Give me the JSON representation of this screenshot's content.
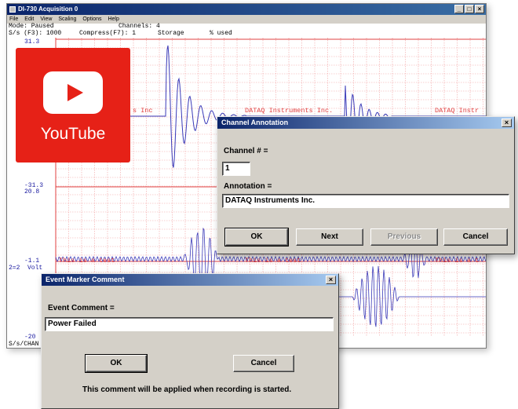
{
  "main_window": {
    "title": "DI-730 Acquisition 0",
    "controls": [
      "_",
      "□",
      "×"
    ],
    "menu": [
      "File",
      "Edit",
      "View",
      "Scaling",
      "Options",
      "Help"
    ],
    "status_line1": [
      "Mode: Paused",
      "Channels: 4"
    ],
    "status_line2": [
      "S/s (F3): 1000",
      "Compress(F7): 1",
      "Storage",
      "% used"
    ],
    "scale_labels": {
      "ch1_top": "31.3",
      "ch1_bottom": "-31.3",
      "ch2_top": "20.8",
      "ch2_bottom": "-1.1",
      "ch2_unit": "2=2  Volt",
      "ch3_bottom": "-20"
    },
    "annotations_top": [
      "s Inc",
      "DATAQ Instruments Inc.",
      "DATAQ Instr"
    ],
    "annotations_bottom": [
      "This is a test",
      "This is a test",
      "This is a t"
    ],
    "bottom_label": "S/s/CHAN"
  },
  "youtube_badge": {
    "word": "YouTube",
    "icon": "play-icon",
    "brand_color": "#e62117"
  },
  "channel_dialog": {
    "title": "Channel Annotation",
    "close": "×",
    "channel_label": "Channel # =",
    "channel_value": "1",
    "annotation_label": "Annotation =",
    "annotation_value": "DATAQ Instruments Inc.",
    "buttons": {
      "ok": "OK",
      "next": "Next",
      "previous": "Previous",
      "cancel": "Cancel"
    }
  },
  "event_dialog": {
    "title": "Event Marker Comment",
    "close": "×",
    "comment_label": "Event Comment =",
    "comment_value": "Power Failed",
    "buttons": {
      "ok": "OK",
      "cancel": "Cancel"
    },
    "note": "This comment will be applied when recording is started."
  }
}
